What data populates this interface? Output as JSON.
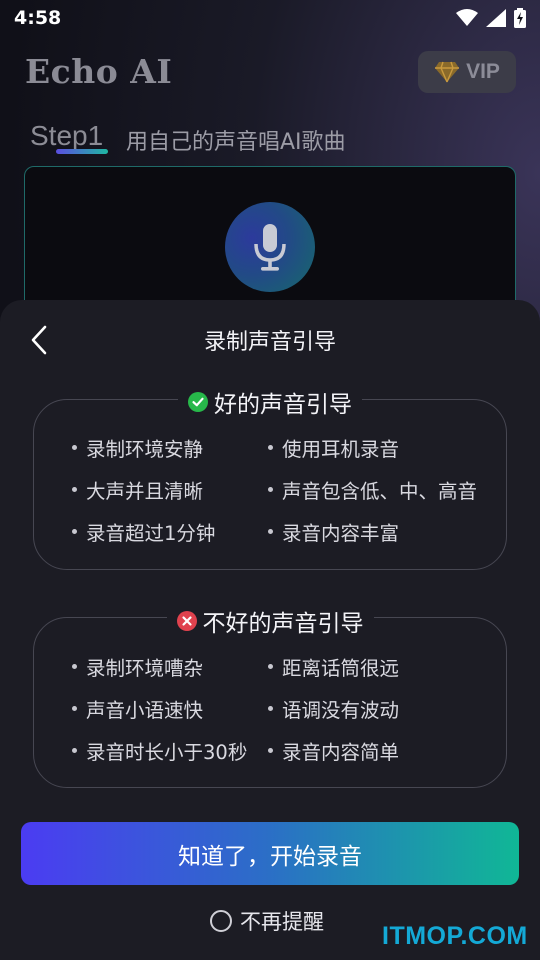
{
  "status_bar": {
    "time": "4:58",
    "icons": [
      "wifi-icon",
      "signal-icon",
      "battery-charging-icon"
    ]
  },
  "app": {
    "title": "Echo AI",
    "vip_label": "VIP",
    "step_label": "Step1",
    "step_description": "用自己的声音唱AI歌曲"
  },
  "sheet": {
    "title": "录制声音引导",
    "good": {
      "heading": "好的声音引导",
      "items": [
        "录制环境安静",
        "使用耳机录音",
        "大声并且清晰",
        "声音包含低、中、高音",
        "录音超过1分钟",
        "录音内容丰富"
      ]
    },
    "bad": {
      "heading": "不好的声音引导",
      "items": [
        "录制环境嘈杂",
        "距离话筒很远",
        "声音小语速快",
        "语调没有波动",
        "录音时长小于30秒",
        "录音内容简单"
      ]
    },
    "confirm_label": "知道了，开始录音",
    "no_remind_label": "不再提醒"
  },
  "watermark": "ITMOP.COM",
  "colors": {
    "accent_start": "#4b3cf2",
    "accent_end": "#10b796",
    "good": "#27b84a",
    "bad": "#e0424e",
    "watermark": "#14a9d6"
  }
}
